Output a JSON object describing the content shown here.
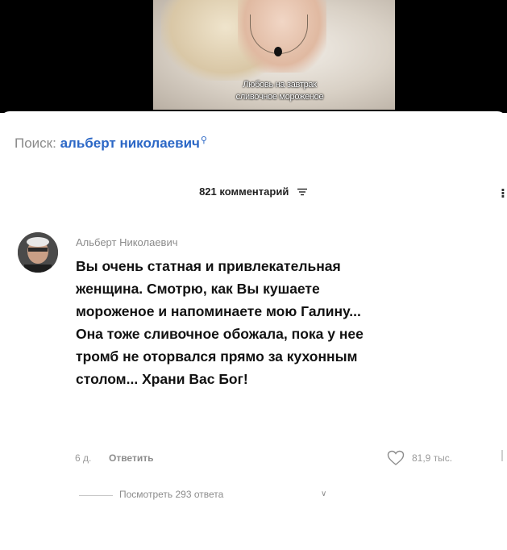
{
  "video": {
    "caption_lines": [
      "Любовь на завтрак",
      "сливочное мороженое"
    ]
  },
  "search": {
    "prefix": "Поиск:",
    "query": "альберт николаевич",
    "icon": "search-icon"
  },
  "comments_header": {
    "count_label": "821 комментарий",
    "filter_icon": "filter-icon"
  },
  "comment": {
    "author": "Альберт Николаевич",
    "lines": [
      "Вы очень статная и привлекательная",
      "женщина. Смотрю, как Вы кушаете",
      "мороженое и напоминаете мою Галину...",
      "Она тоже сливочное обожала, пока у нее",
      "тромб не оторвался прямо за кухонным",
      "столом... Храни Вас Бог!"
    ],
    "time": "6 д.",
    "reply_label": "Ответить",
    "likes": "81,9 тыс.",
    "like_icon": "heart-icon",
    "view_replies": "Посмотреть 293 ответа",
    "chevron_icon": "chevron-down-icon"
  },
  "colors": {
    "link_blue": "#2b67c6",
    "text": "#111111",
    "muted": "#8c8c8c"
  }
}
